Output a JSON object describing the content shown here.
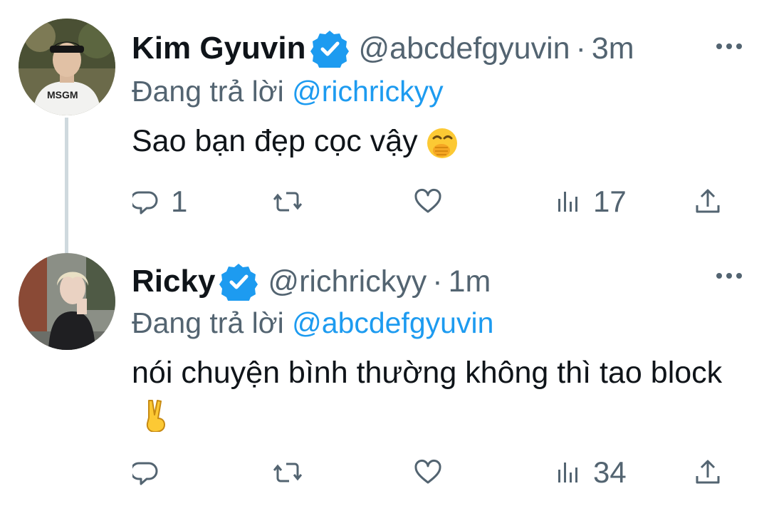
{
  "tweets": [
    {
      "name": "Kim Gyuvin",
      "handle": "@abcdefgyuvin",
      "separator": "·",
      "time": "3m",
      "reply_prefix": "Đang trả lời",
      "reply_to": "@richrickyy",
      "text": "Sao bạn đẹp cọc vậy",
      "emoji": "face-with-hand-over-mouth",
      "actions": {
        "replies": "1",
        "retweets": "",
        "likes": "",
        "views": "17"
      }
    },
    {
      "name": "Ricky",
      "handle": "@richrickyy",
      "separator": "·",
      "time": "1m",
      "reply_prefix": "Đang trả lời",
      "reply_to": "@abcdefgyuvin",
      "text": "nói chuyện bình thường không thì tao block",
      "emoji": "victory-hand",
      "actions": {
        "replies": "",
        "retweets": "",
        "likes": "",
        "views": "34"
      }
    }
  ],
  "colors": {
    "accent": "#1d9bf0",
    "secondary_text": "#536471",
    "primary_text": "#0f1419",
    "thread_line": "#cfd9de"
  }
}
